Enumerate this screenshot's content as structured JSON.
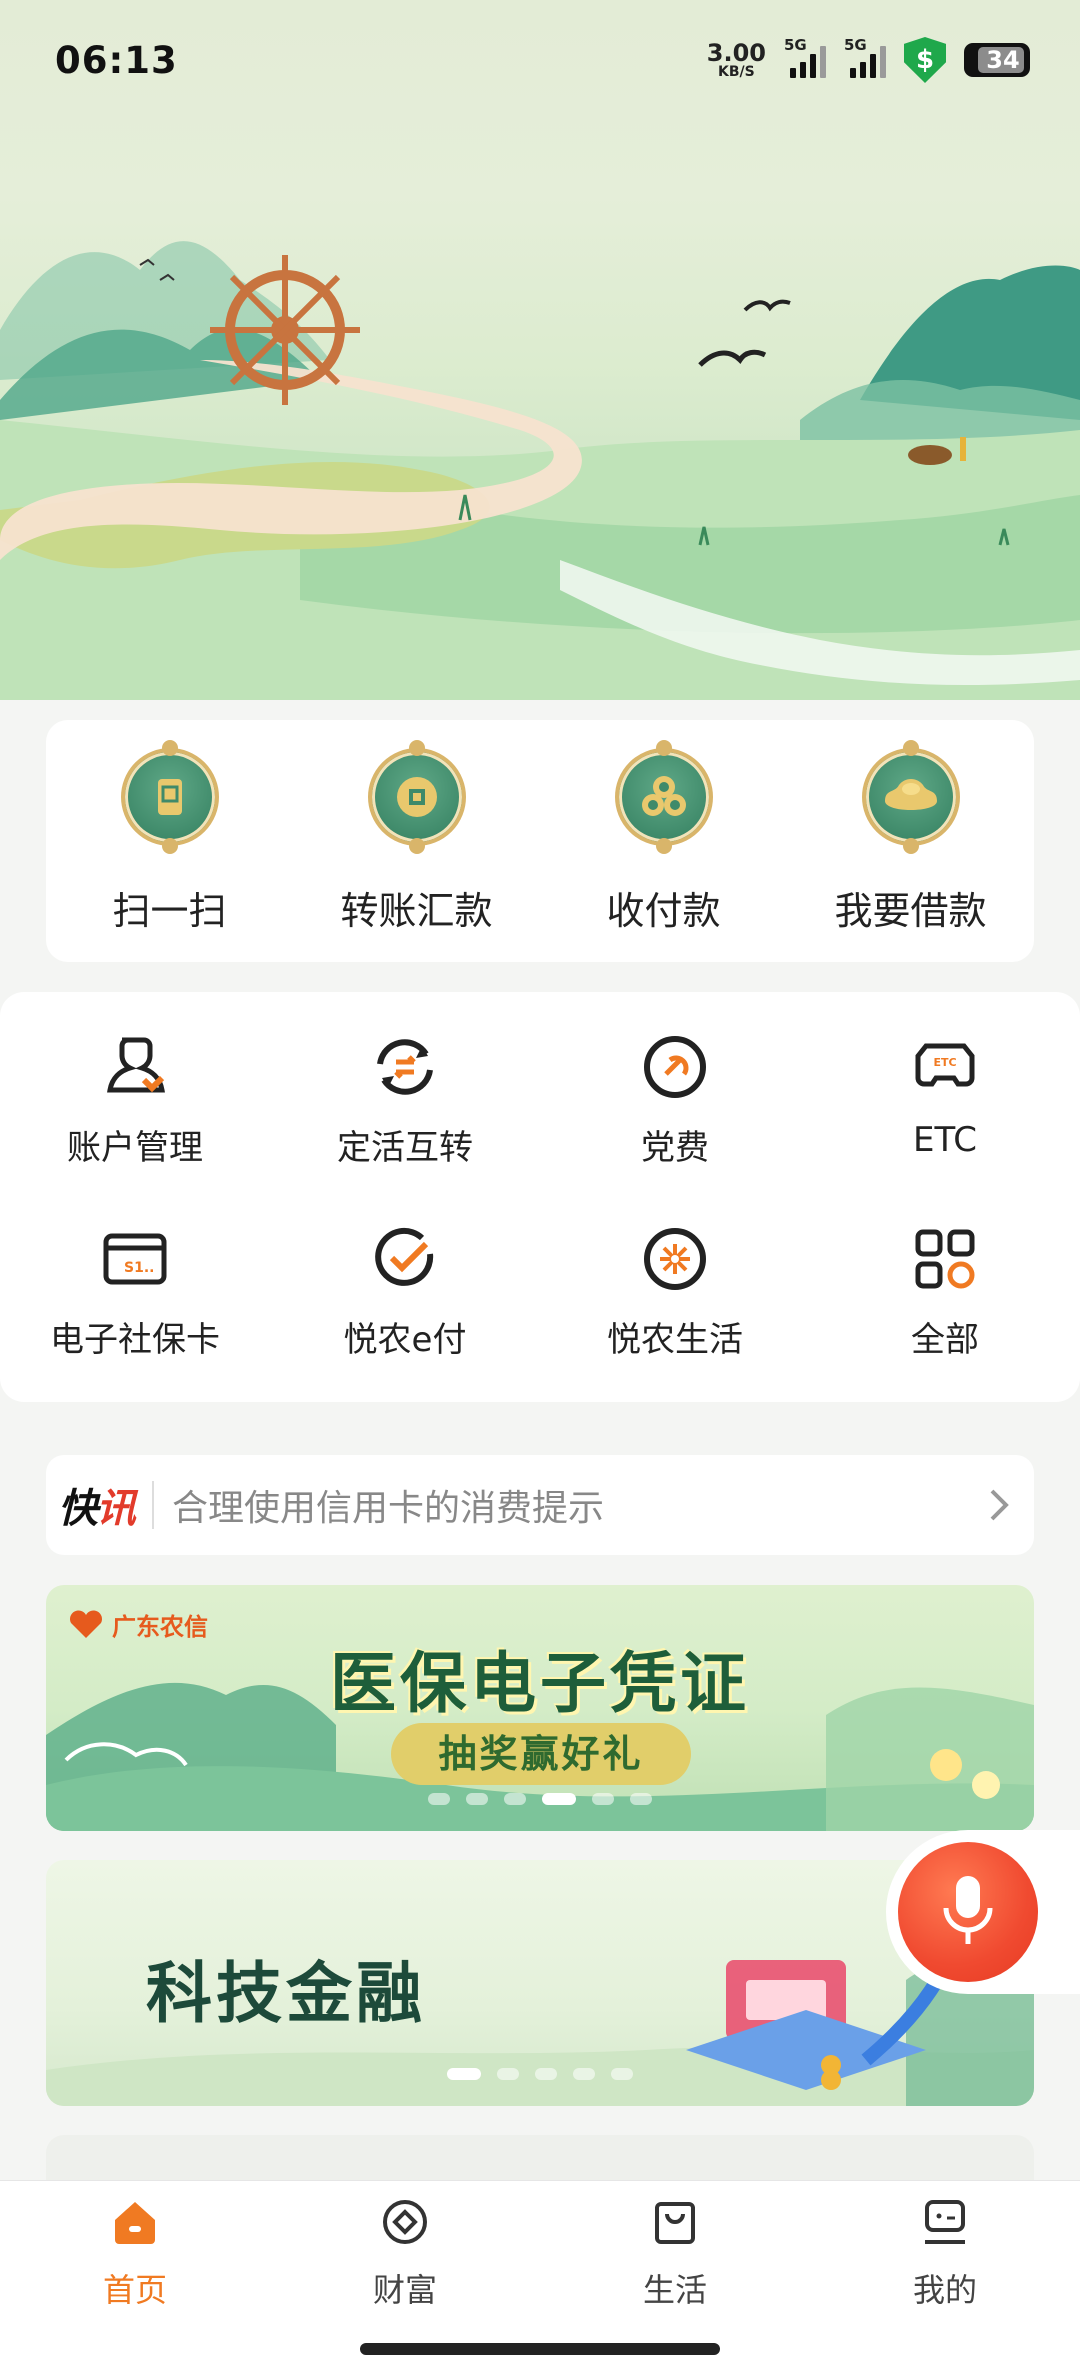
{
  "status_bar": {
    "time": "06:13",
    "net_speed": "3.00",
    "net_unit": "KB/S",
    "sim1": "5G",
    "sim2": "5G",
    "battery": "34"
  },
  "quick_actions": [
    {
      "label": "扫一扫",
      "icon": "scan-icon"
    },
    {
      "label": "转账汇款",
      "icon": "transfer-icon"
    },
    {
      "label": "收付款",
      "icon": "payment-icon"
    },
    {
      "label": "我要借款",
      "icon": "loan-icon"
    }
  ],
  "services": [
    {
      "label": "账户管理",
      "icon": "account-icon"
    },
    {
      "label": "定活互转",
      "icon": "exchange-icon"
    },
    {
      "label": "党费",
      "icon": "party-fee-icon"
    },
    {
      "label": "ETC",
      "icon": "etc-car-icon"
    },
    {
      "label": "电子社保卡",
      "icon": "social-security-card-icon"
    },
    {
      "label": "悦农e付",
      "icon": "epay-icon"
    },
    {
      "label": "悦农生活",
      "icon": "life-icon"
    },
    {
      "label": "全部",
      "icon": "all-grid-icon"
    }
  ],
  "ticker": {
    "tag_main": "快",
    "tag_accent": "讯",
    "message": "合理使用信用卡的消费提示"
  },
  "banner1": {
    "brand": "广东农信",
    "title": "医保电子凭证",
    "subtitle": "抽奖赢好礼"
  },
  "banner2": {
    "title": "科技金融"
  },
  "tabbar": [
    {
      "label": "首页",
      "icon": "home-icon",
      "active": true
    },
    {
      "label": "财富",
      "icon": "wealth-icon",
      "active": false
    },
    {
      "label": "生活",
      "icon": "life-bag-icon",
      "active": false
    },
    {
      "label": "我的",
      "icon": "profile-icon",
      "active": false
    }
  ],
  "colors": {
    "accent": "#f07a22",
    "brand_green": "#3f8a6a",
    "gold": "#d9b56a",
    "voice_red": "#f04a30"
  }
}
